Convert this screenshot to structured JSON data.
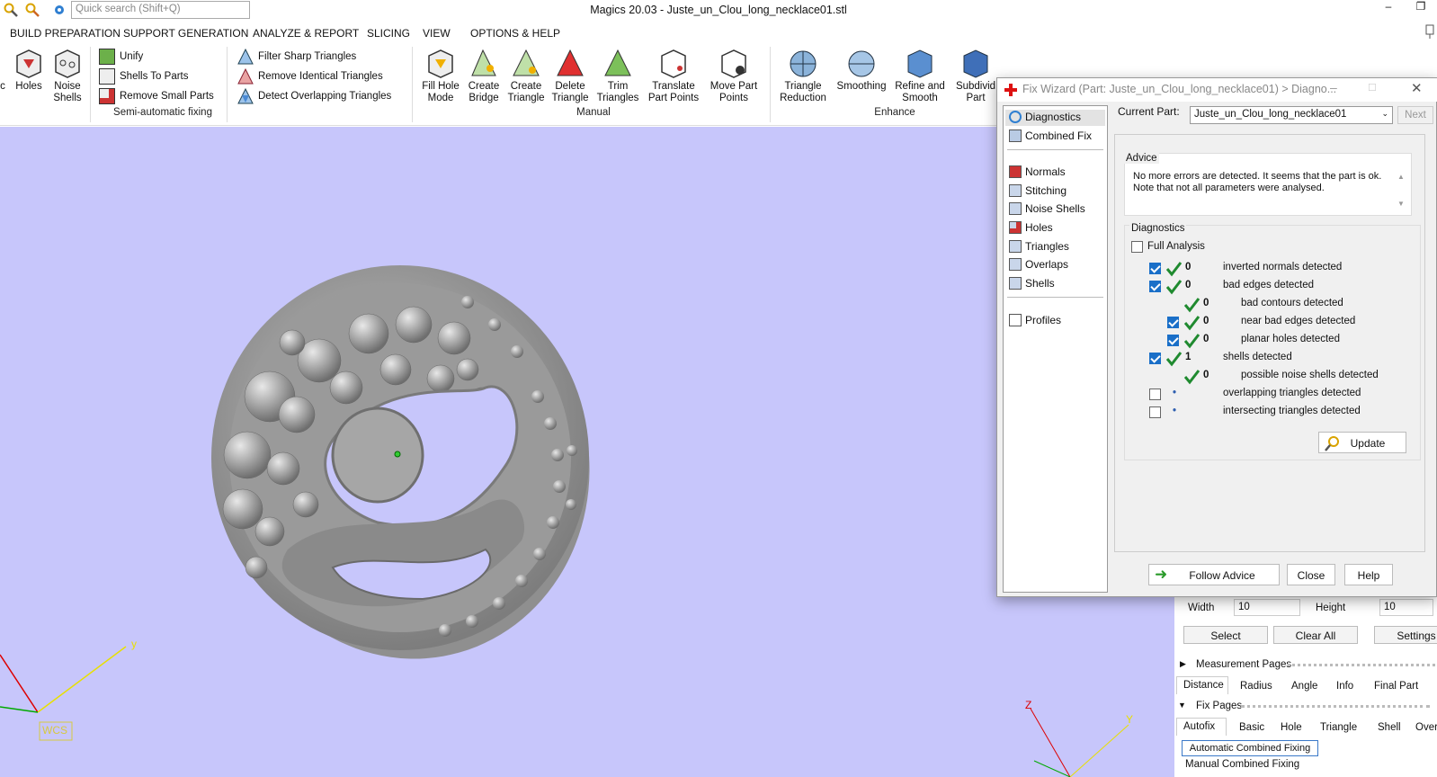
{
  "window": {
    "title": "Magics 20.03 - Juste_un_Clou_long_necklace01.stl",
    "search_placeholder": "Quick search (Shift+Q)"
  },
  "menu": [
    "BUILD PREPARATION",
    "SUPPORT GENERATION",
    "ANALYZE & REPORT",
    "SLICING",
    "VIEW",
    "OPTIONS & HELP"
  ],
  "ribbon": {
    "big_left": [
      {
        "l1": "c",
        "l2": ""
      },
      {
        "l1": "Holes",
        "l2": ""
      },
      {
        "l1": "Noise",
        "l2": "Shells"
      }
    ],
    "semi": [
      "Unify",
      "Shells To Parts",
      "Remove Small Parts"
    ],
    "semi_group": "Semi-automatic fixing",
    "tri": [
      "Filter Sharp Triangles",
      "Remove Identical Triangles",
      "Detect Overlapping Triangles"
    ],
    "manual": [
      {
        "l1": "Fill Hole",
        "l2": "Mode"
      },
      {
        "l1": "Create",
        "l2": "Bridge"
      },
      {
        "l1": "Create",
        "l2": "Triangle"
      },
      {
        "l1": "Delete",
        "l2": "Triangle"
      },
      {
        "l1": "Trim",
        "l2": "Triangles"
      },
      {
        "l1": "Translate",
        "l2": "Part Points"
      },
      {
        "l1": "Move Part",
        "l2": "Points"
      }
    ],
    "manual_group": "Manual",
    "enhance": [
      {
        "l1": "Triangle",
        "l2": "Reduction"
      },
      {
        "l1": "Smoothing",
        "l2": ""
      },
      {
        "l1": "Refine and",
        "l2": "Smooth"
      },
      {
        "l1": "Subdivid",
        "l2": "Part"
      }
    ],
    "enhance_group": "Enhance"
  },
  "dialog": {
    "title": "Fix Wizard (Part: Juste_un_Clou_long_necklace01) > Diagno...",
    "nav": [
      "Diagnostics",
      "Combined Fix",
      "Normals",
      "Stitching",
      "Noise Shells",
      "Holes",
      "Triangles",
      "Overlaps",
      "Shells",
      "Profiles"
    ],
    "current_part_label": "Current Part:",
    "current_part": "Juste_un_Clou_long_necklace01",
    "next": "Next",
    "advice_label": "Advice",
    "advice_text": "No more errors are detected. It seems that the part is ok. Note that not all parameters were analysed.",
    "diagnostics_label": "Diagnostics",
    "full_analysis": "Full Analysis",
    "rows": [
      {
        "checked": true,
        "ok": true,
        "value": "0",
        "label": "inverted normals detected",
        "indent": 0
      },
      {
        "checked": true,
        "ok": true,
        "value": "0",
        "label": "bad edges detected",
        "indent": 0
      },
      {
        "checked": null,
        "ok": true,
        "value": "0",
        "label": "bad contours detected",
        "indent": 1
      },
      {
        "checked": true,
        "ok": true,
        "value": "0",
        "label": "near bad edges detected",
        "indent": 1
      },
      {
        "checked": true,
        "ok": true,
        "value": "0",
        "label": "planar holes detected",
        "indent": 1
      },
      {
        "checked": true,
        "ok": true,
        "value": "1",
        "label": "shells detected",
        "indent": 0
      },
      {
        "checked": null,
        "ok": true,
        "value": "0",
        "label": "possible noise shells detected",
        "indent": 1
      },
      {
        "checked": false,
        "ok": false,
        "value": "•",
        "label": "overlapping triangles detected",
        "indent": 0
      },
      {
        "checked": false,
        "ok": false,
        "value": "•",
        "label": "intersecting triangles detected",
        "indent": 0
      }
    ],
    "update": "Update",
    "follow_advice": "Follow Advice",
    "close": "Close",
    "help": "Help"
  },
  "rightpanel": {
    "width_label": "Width",
    "width_value": "10",
    "height_label": "Height",
    "height_value": "10",
    "select": "Select",
    "clear_all": "Clear All",
    "settings": "Settings",
    "measurement_pages": "Measurement Pages",
    "measure_tabs": [
      "Distance",
      "Radius",
      "Angle",
      "Info",
      "Final Part"
    ],
    "fix_pages": "Fix Pages",
    "fix_tabs": [
      "Autofix",
      "Basic",
      "Hole",
      "Triangle",
      "Shell",
      "Over"
    ],
    "auto_combined": "Automatic Combined Fixing",
    "manual_combined": "Manual Combined Fixing"
  },
  "viewport": {
    "wcs": "WCS",
    "y_axis": "y",
    "z_axis": "Z",
    "y2_axis": "Y"
  }
}
